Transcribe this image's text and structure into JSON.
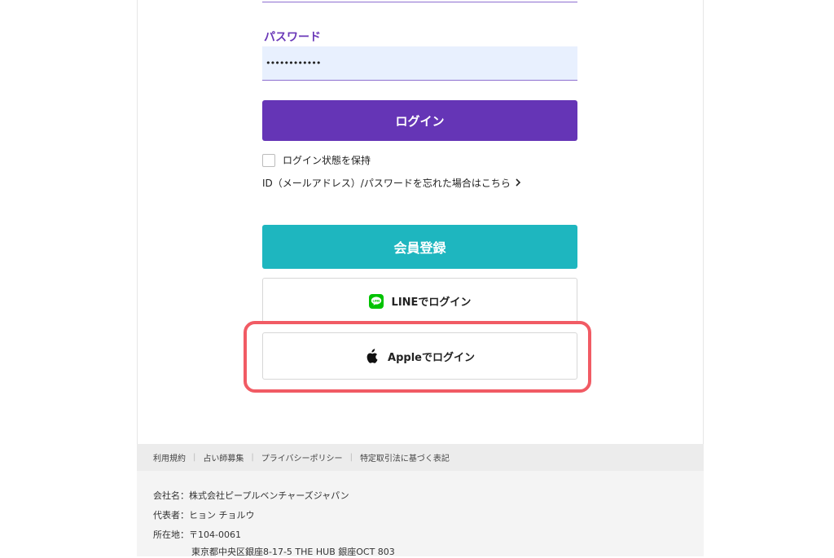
{
  "password": {
    "label": "パスワード",
    "value": "••••••••••••"
  },
  "buttons": {
    "login": "ログイン",
    "register": "会員登録",
    "line_login": "LINEでログイン",
    "apple_login": "Appleでログイン"
  },
  "keep_login": {
    "label": "ログイン状態を保持",
    "checked": false
  },
  "forgot_link": "ID（メールアドレス）/パスワードを忘れた場合はこちら",
  "icons": {
    "line": "line-icon",
    "apple": "apple-icon",
    "chevron": "chevron-right-icon"
  },
  "colors": {
    "primary": "#6535b6",
    "teal": "#1eb6bf",
    "line_green": "#00c300",
    "highlight": "#f15b64"
  },
  "footer": {
    "links": [
      "利用規約",
      "占い師募集",
      "プライバシーポリシー",
      "特定取引法に基づく表記"
    ],
    "company": "会社名：株式会社ピープルベンチャーズジャパン",
    "representative": "代表者：ヒョン チョルウ",
    "address_line1": "所在地：〒104-0061",
    "address_line2": "東京都中央区銀座8-17-5 THE HUB 銀座OCT 803"
  }
}
